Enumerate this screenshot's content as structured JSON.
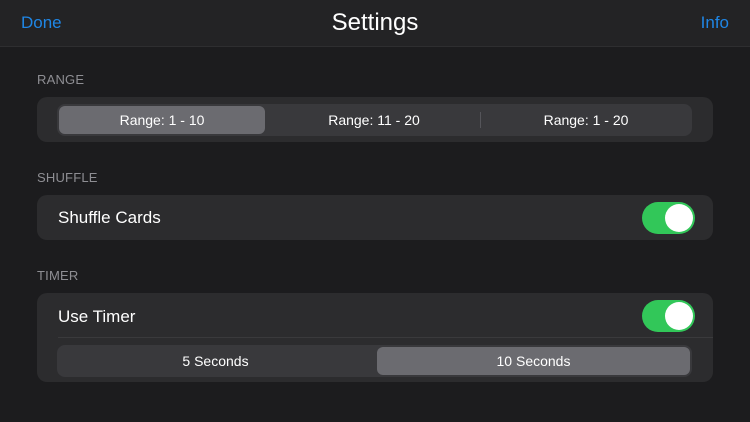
{
  "navbar": {
    "done_label": "Done",
    "title": "Settings",
    "info_label": "Info",
    "accent_color": "#1f86e5"
  },
  "range": {
    "header": "RANGE",
    "segments": [
      "Range: 1 - 10",
      "Range: 11 - 20",
      "Range: 1 - 20"
    ],
    "selected_index": 0
  },
  "shuffle": {
    "header": "SHUFFLE",
    "label": "Shuffle Cards",
    "enabled": true
  },
  "timer": {
    "header": "TIMER",
    "label": "Use Timer",
    "enabled": true,
    "segments": [
      "5 Seconds",
      "10 Seconds"
    ],
    "selected_index": 1
  },
  "colors": {
    "background": "#1c1c1e",
    "group": "#2c2c2e",
    "toggle_on": "#32c759"
  }
}
